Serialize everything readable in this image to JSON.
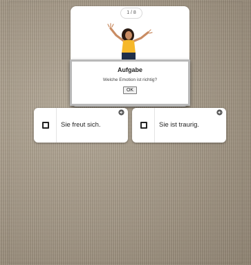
{
  "quiz": {
    "counter": "1 / 8",
    "illustration_icon": "excited-woman-illustration"
  },
  "dialog": {
    "title": "Aufgabe",
    "message": "Welche Emotion ist richtig?",
    "ok_label": "OK"
  },
  "answers": [
    {
      "label": "Sie freut sich.",
      "icon": "speaker-icon"
    },
    {
      "label": "Sie ist traurig.",
      "icon": "speaker-icon"
    }
  ],
  "colors": {
    "card": "#ffffff",
    "shirt": "#f6b82a",
    "pants": "#1f2f4a",
    "hair": "#2a1a12"
  }
}
